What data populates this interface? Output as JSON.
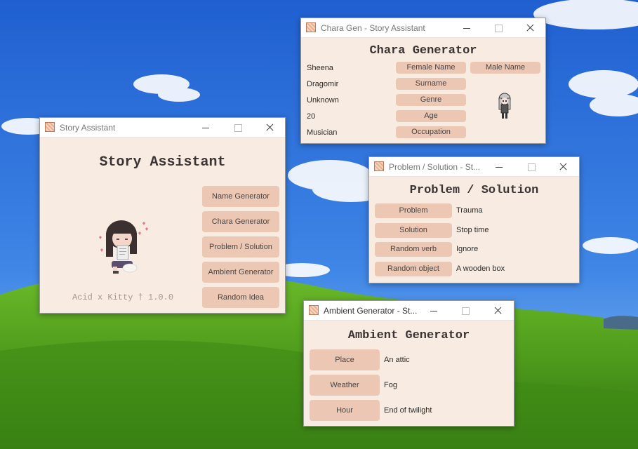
{
  "colors": {
    "window_bg": "#f8ebe1",
    "button_bg": "#ecc8b4",
    "sky": "#2f6fd6",
    "grass": "#4e9a1c"
  },
  "story_window": {
    "title": "Story Assistant",
    "heading": "Story Assistant",
    "buttons": [
      "Name Generator",
      "Chara Generator",
      "Problem / Solution",
      "Ambient Generator",
      "Random Idea"
    ],
    "footer": "Acid x Kitty † 1.0.0"
  },
  "chara_window": {
    "title": "Chara Gen - Story Assistant",
    "heading": "Chara Generator",
    "values": {
      "name": "Sheena",
      "surname": "Dragomir",
      "genre": "Unknown",
      "age": "20",
      "occupation": "Musician"
    },
    "buttons": {
      "female_name": "Female Name",
      "male_name": "Male Name",
      "surname": "Surname",
      "genre": "Genre",
      "age": "Age",
      "occupation": "Occupation"
    }
  },
  "problem_window": {
    "title": "Problem / Solution - St...",
    "heading": "Problem / Solution",
    "rows": [
      {
        "button": "Problem",
        "value": "Trauma"
      },
      {
        "button": "Solution",
        "value": "Stop time"
      },
      {
        "button": "Random verb",
        "value": "Ignore"
      },
      {
        "button": "Random object",
        "value": "A wooden box"
      }
    ]
  },
  "ambient_window": {
    "title": "Ambient Generator - St...",
    "heading": "Ambient Generator",
    "rows": [
      {
        "button": "Place",
        "value": "An attic"
      },
      {
        "button": "Weather",
        "value": "Fog"
      },
      {
        "button": "Hour",
        "value": "End of twilight"
      }
    ]
  }
}
